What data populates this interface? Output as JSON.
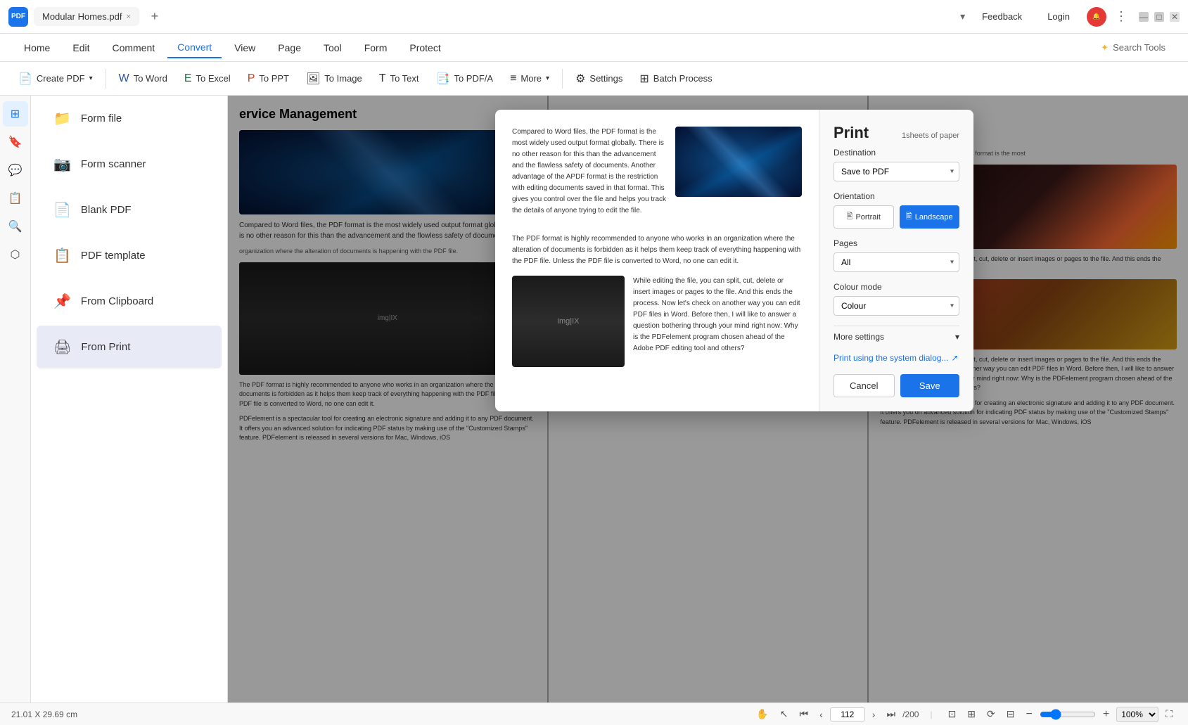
{
  "titlebar": {
    "logo": "PDF",
    "tab_title": "Modular Homes.pdf",
    "close_tab": "×",
    "new_tab": "+",
    "feedback": "Feedback",
    "login": "Login",
    "dots": "⋮",
    "minimize": "—",
    "maximize": "□",
    "close": "×"
  },
  "menubar": {
    "items": [
      {
        "label": "Home",
        "active": false
      },
      {
        "label": "Edit",
        "active": false
      },
      {
        "label": "Comment",
        "active": false
      },
      {
        "label": "Convert",
        "active": true
      },
      {
        "label": "View",
        "active": false
      },
      {
        "label": "Page",
        "active": false
      },
      {
        "label": "Tool",
        "active": false
      },
      {
        "label": "Form",
        "active": false
      },
      {
        "label": "Protect",
        "active": false
      }
    ],
    "search_placeholder": "Search Tools"
  },
  "toolbar": {
    "create_pdf": "Create PDF",
    "to_word": "To Word",
    "to_excel": "To Excel",
    "to_ppt": "To PPT",
    "to_image": "To Image",
    "to_text": "To Text",
    "to_pdfa": "To PDF/A",
    "more": "More",
    "settings": "Settings",
    "batch_process": "Batch Process"
  },
  "left_panel": {
    "items": [
      {
        "icon": "📁",
        "label": "Form file"
      },
      {
        "icon": "📷",
        "label": "Form scanner"
      },
      {
        "icon": "📄",
        "label": "Blank PDF"
      },
      {
        "icon": "📋",
        "label": "PDF template"
      },
      {
        "icon": "📌",
        "label": "From Clipboard"
      },
      {
        "icon": "🖨",
        "label": "From Print",
        "active": true
      }
    ]
  },
  "print_dialog": {
    "title": "Print",
    "sheets_info": "1sheets of paper",
    "destination_label": "Destination",
    "destination_value": "Save to PDF",
    "orientation_label": "Orientation",
    "portrait_label": "Portrait",
    "landscape_label": "Landscape",
    "pages_label": "Pages",
    "pages_value": "All",
    "color_mode_label": "Colour mode",
    "color_mode_value": "Colour",
    "more_settings": "More settings",
    "system_dialog": "Print using the system dialog...",
    "cancel": "Cancel",
    "save": "Save",
    "text1": "Compared to Word files, the PDF format is the most widely used output format globally. There is no other reason for this than the advancement and the flawless safety of documents. Another advantage of the APDF format is the restriction with editing documents saved in that format. This gives you control over the file and helps you track the details of anyone trying to edit the file.",
    "text2": "The PDF format is highly recommended to anyone who works in an organization where the alteration of documents is forbidden as it helps them keep track of everything happening with the PDF file. Unless the PDF file is converted to Word, no one can edit it.",
    "text3": "While editing the file, you can split, cut, delete or insert images or pages to the file. And this ends the process. Now let's check on another way you can edit PDF files in Word. Before then, I will like to answer a question bothering through your mind right now: Why is the PDFelement program chosen ahead of the Adobe PDF editing tool and others?"
  },
  "statusbar": {
    "dimensions": "21.01 X 29.69 cm",
    "page_current": "112",
    "page_total": "/200",
    "zoom_level": "100%"
  }
}
